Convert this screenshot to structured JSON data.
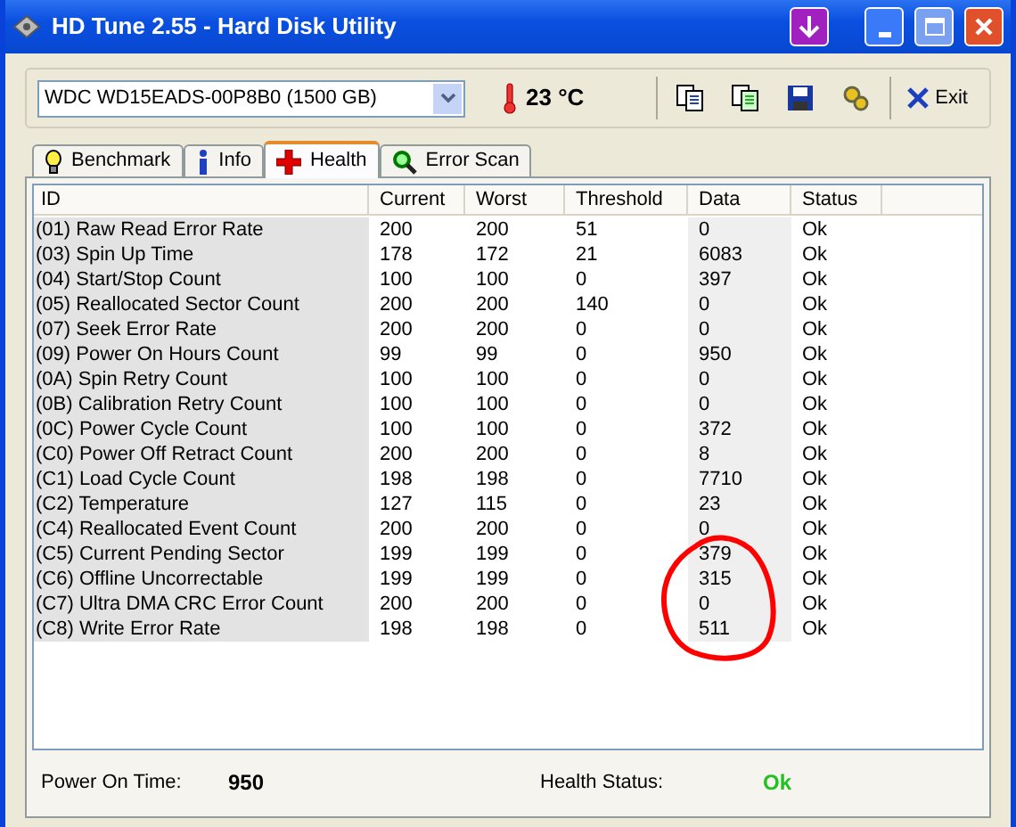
{
  "window": {
    "title": "HD Tune 2.55 - Hard Disk Utility"
  },
  "toolbar": {
    "drive": "WDC WD15EADS-00P8B0 (1500 GB)",
    "temperature": "23 °C",
    "exit": "Exit"
  },
  "tabs": [
    {
      "label": "Benchmark",
      "selected": false,
      "kind": "bulb"
    },
    {
      "label": "Info",
      "selected": false,
      "kind": "info"
    },
    {
      "label": "Health",
      "selected": true,
      "kind": "cross"
    },
    {
      "label": "Error Scan",
      "selected": false,
      "kind": "magnifier"
    }
  ],
  "table": {
    "columns": [
      "ID",
      "Current",
      "Worst",
      "Threshold",
      "Data",
      "Status"
    ],
    "rows": [
      [
        "(01) Raw Read Error Rate",
        "200",
        "200",
        "51",
        "0",
        "Ok"
      ],
      [
        "(03) Spin Up Time",
        "178",
        "172",
        "21",
        "6083",
        "Ok"
      ],
      [
        "(04) Start/Stop Count",
        "100",
        "100",
        "0",
        "397",
        "Ok"
      ],
      [
        "(05) Reallocated Sector Count",
        "200",
        "200",
        "140",
        "0",
        "Ok"
      ],
      [
        "(07) Seek Error Rate",
        "200",
        "200",
        "0",
        "0",
        "Ok"
      ],
      [
        "(09) Power On Hours Count",
        "99",
        "99",
        "0",
        "950",
        "Ok"
      ],
      [
        "(0A) Spin Retry Count",
        "100",
        "100",
        "0",
        "0",
        "Ok"
      ],
      [
        "(0B) Calibration Retry Count",
        "100",
        "100",
        "0",
        "0",
        "Ok"
      ],
      [
        "(0C) Power Cycle Count",
        "100",
        "100",
        "0",
        "372",
        "Ok"
      ],
      [
        "(C0) Power Off Retract Count",
        "200",
        "200",
        "0",
        "8",
        "Ok"
      ],
      [
        "(C1) Load Cycle Count",
        "198",
        "198",
        "0",
        "7710",
        "Ok"
      ],
      [
        "(C2) Temperature",
        "127",
        "115",
        "0",
        "23",
        "Ok"
      ],
      [
        "(C4) Reallocated Event Count",
        "200",
        "200",
        "0",
        "0",
        "Ok"
      ],
      [
        "(C5) Current Pending Sector",
        "199",
        "199",
        "0",
        "379",
        "Ok"
      ],
      [
        "(C6) Offline Uncorrectable",
        "199",
        "199",
        "0",
        "315",
        "Ok"
      ],
      [
        "(C7) Ultra DMA CRC Error Count",
        "200",
        "200",
        "0",
        "0",
        "Ok"
      ],
      [
        "(C8) Write Error Rate",
        "198",
        "198",
        "0",
        "511",
        "Ok"
      ]
    ]
  },
  "status_bar": {
    "power_on_label": "Power On Time:",
    "power_on_value": "950",
    "health_label": "Health Status:",
    "health_value": "Ok"
  }
}
